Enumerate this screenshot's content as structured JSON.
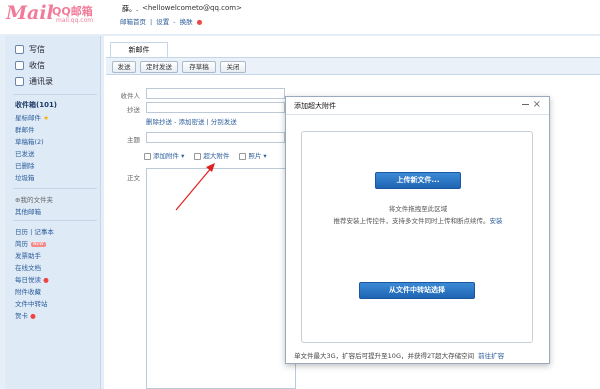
{
  "header": {
    "logo_mark": "Mail",
    "logo_text": "QQ邮箱",
    "logo_domain": "mail.qq.com",
    "user_name": "薛。.",
    "user_email": "<hellowelcometo@qq.com>",
    "links": [
      "邮箱首页",
      "|",
      "设置",
      "-",
      "换肤"
    ]
  },
  "sidebar": {
    "quick": [
      {
        "label": "写信",
        "icon": "pen-icon"
      },
      {
        "label": "收信",
        "icon": "inbox-icon"
      },
      {
        "label": "通讯录",
        "icon": "contacts-icon"
      }
    ],
    "folders": [
      "收件箱(101)",
      "星标邮件",
      "群邮件",
      "草稿箱(2)",
      "已发送",
      "已删除",
      "垃圾箱"
    ],
    "my_folders": "我的文件夹",
    "other_mail": "其他邮箱",
    "apps": [
      "日历",
      "|",
      "记事本",
      "简历",
      "发票助手",
      "在线文档",
      "每日悦读",
      "附件收藏",
      "文件中转站",
      "贺卡"
    ],
    "badge": "NEW"
  },
  "compose": {
    "tab": "新邮件",
    "toolbar": [
      "发送",
      "定时发送",
      "存草稿",
      "关闭"
    ],
    "labels": {
      "to": "收件人",
      "cc": "抄送",
      "subject": "主题",
      "body": "正文"
    },
    "sublinks": "删除抄送 - 添加密送 | 分别发送",
    "attach": [
      "添加附件",
      "超大附件",
      "照片"
    ]
  },
  "dialog": {
    "title": "添加超大附件",
    "upload_label": "上传新文件...",
    "drag_hint": "将文件拖拽至此区域",
    "plugin_hint": "推荐安装上传控件，支持多文件同时上传和断点续传。",
    "install_link": "安装",
    "transfer_label": "从文件中转站选择",
    "footer_text": "单文件最大3G，扩容后可提升至10G，并获得2T超大存储空间",
    "footer_link": "前往扩容"
  }
}
